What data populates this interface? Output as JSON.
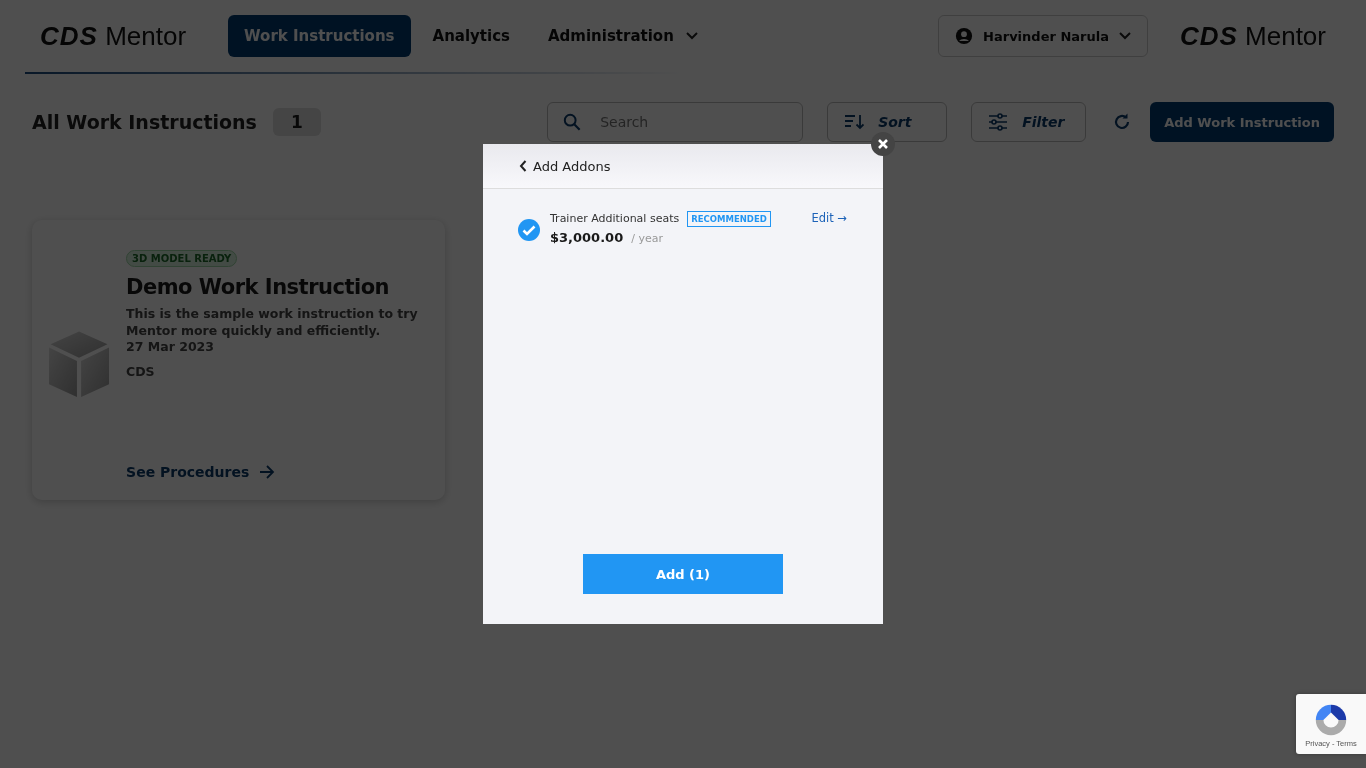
{
  "logo": {
    "mark": "CDS",
    "name": "Mentor"
  },
  "nav": [
    {
      "label": "Work Instructions",
      "selected": true,
      "has_menu": false
    },
    {
      "label": "Analytics",
      "selected": false,
      "has_menu": false
    },
    {
      "label": "Administration",
      "selected": false,
      "has_menu": true
    }
  ],
  "user": {
    "name": "Harvinder Narula"
  },
  "partner_logo": {
    "mark": "CDS",
    "name": "Mentor"
  },
  "toolbar": {
    "title": "All Work Instructions",
    "count": "1",
    "search_placeholder": "Search",
    "sort": "Sort",
    "filter": "Filter",
    "add": "Add Work Instruction"
  },
  "cards": [
    {
      "badge": "3D MODEL READY",
      "title": "Demo Work Instruction",
      "description": "This is the sample work instruction to try Mentor more quickly and efficiently.",
      "date": "27 Mar 2023",
      "owner": "CDS",
      "link": "See Procedures"
    }
  ],
  "modal": {
    "back": "Add Addons",
    "addons": [
      {
        "name": "Trainer Additional seats",
        "badge": "RECOMMENDED",
        "price": "$3,000.00",
        "period": "/ year",
        "checked": true,
        "edit": "Edit →"
      }
    ],
    "button": "Add (1)"
  },
  "recaptcha": {
    "links": "Privacy - Terms"
  }
}
